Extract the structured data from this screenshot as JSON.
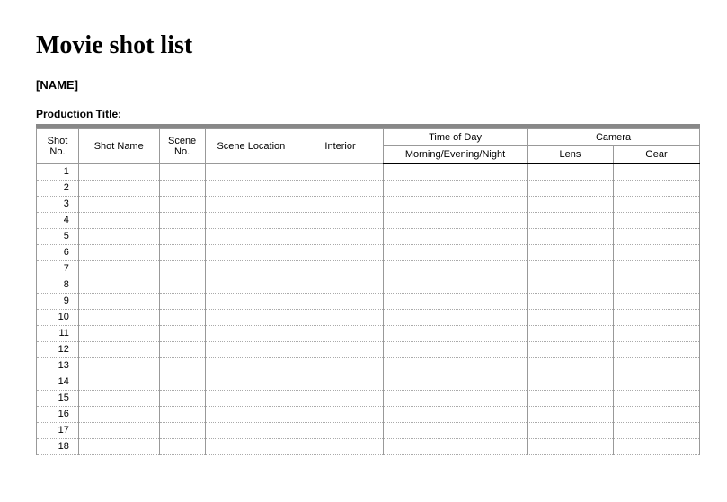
{
  "title": "Movie shot list",
  "name_placeholder": "[NAME]",
  "production_title_label": "Production Title:",
  "headers": {
    "shot_no": "Shot No.",
    "shot_name": "Shot Name",
    "scene_no": "Scene No.",
    "scene_location": "Scene Location",
    "interior": "Interior",
    "time_of_day": "Time of Day",
    "time_of_day_sub": "Morning/Evening/Night",
    "camera": "Camera",
    "lens": "Lens",
    "gear": "Gear"
  },
  "rows": [
    {
      "no": "1"
    },
    {
      "no": "2"
    },
    {
      "no": "3"
    },
    {
      "no": "4"
    },
    {
      "no": "5"
    },
    {
      "no": "6"
    },
    {
      "no": "7"
    },
    {
      "no": "8"
    },
    {
      "no": "9"
    },
    {
      "no": "10"
    },
    {
      "no": "11"
    },
    {
      "no": "12"
    },
    {
      "no": "13"
    },
    {
      "no": "14"
    },
    {
      "no": "15"
    },
    {
      "no": "16"
    },
    {
      "no": "17"
    },
    {
      "no": "18"
    }
  ]
}
